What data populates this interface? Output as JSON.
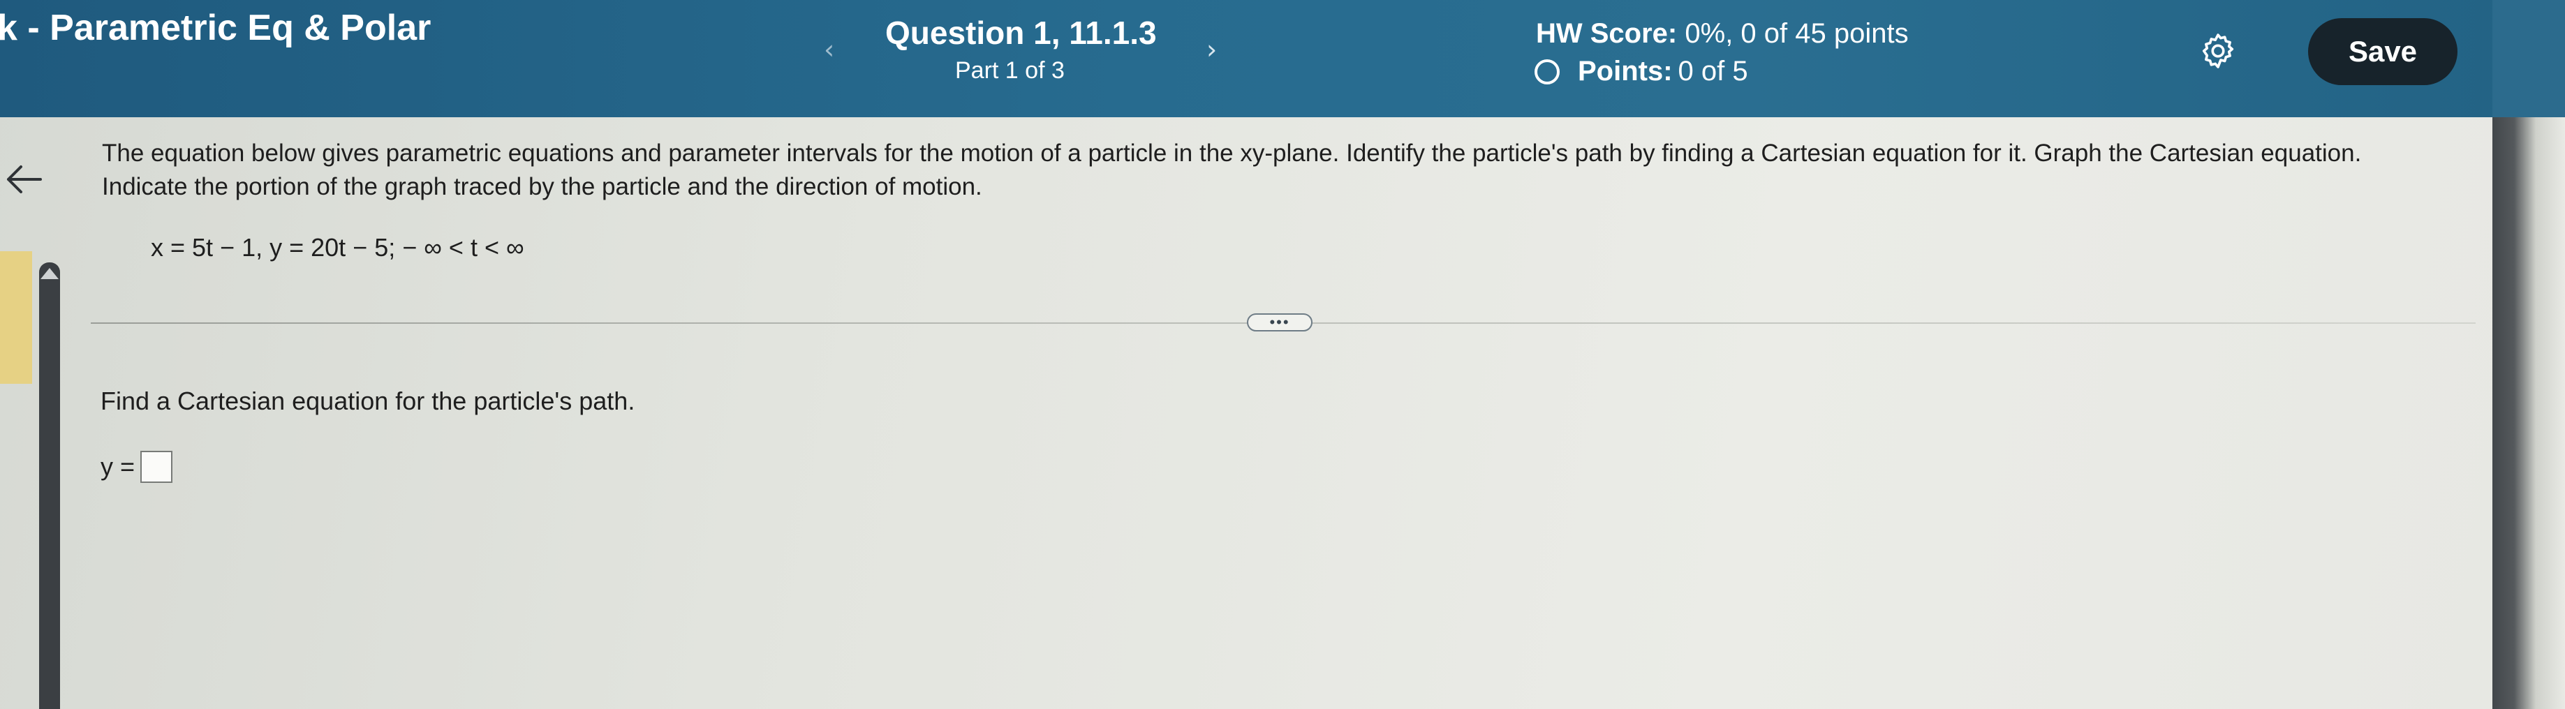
{
  "header": {
    "assignment_title": "k - Parametric Eq & Polar",
    "prev_icon": "chevron-left-icon",
    "next_icon": "chevron-right-icon",
    "question_title": "Question 1, 11.1.3",
    "question_part": "Part 1 of 3",
    "hw_score_label": "HW Score:",
    "hw_score_value": "0%, 0 of 45 points",
    "points_label": "Points:",
    "points_value": "0 of 5",
    "settings_icon": "gear-icon",
    "save_label": "Save"
  },
  "question": {
    "text": "The equation below gives parametric equations and parameter intervals for the motion of a particle in the xy-plane. Identify the particle's path by finding a Cartesian equation for it. Graph the Cartesian equation. Indicate the portion of the graph traced by the particle and the direction of motion.",
    "equation": "x = 5t − 1, y = 20t − 5;  − ∞ < t < ∞",
    "expand_label": "•••",
    "part_prompt": "Find a Cartesian equation for the particle's path.",
    "answer_prefix": "y ="
  },
  "colors": {
    "header_bg": "#276b8f",
    "save_button_bg": "#17232b",
    "page_bg": "#e3e5df",
    "text": "#1e1e1e"
  }
}
